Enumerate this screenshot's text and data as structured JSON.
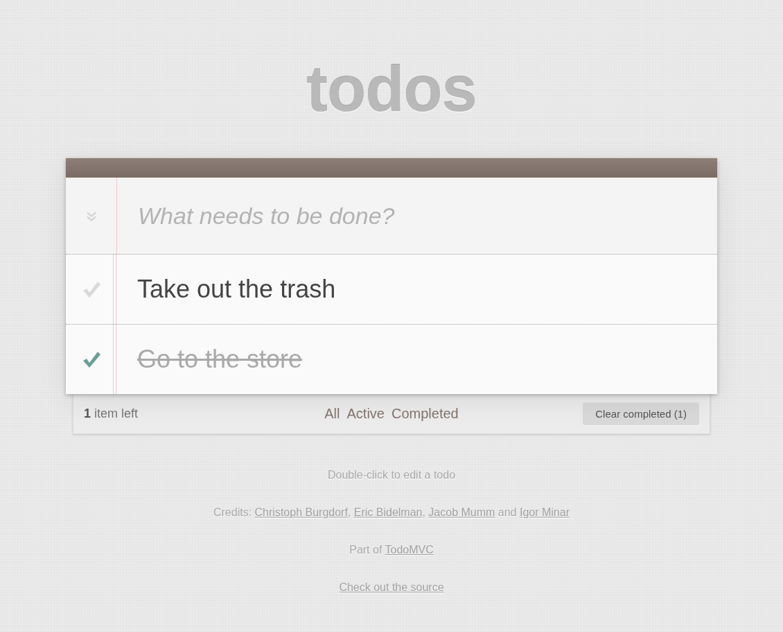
{
  "title": "todos",
  "new_todo": {
    "placeholder": "What needs to be done?",
    "toggle_all_checked": false
  },
  "todos": [
    {
      "title": "Take out the trash",
      "completed": false
    },
    {
      "title": "Go to the store",
      "completed": true
    }
  ],
  "footer": {
    "count": "**1** item left",
    "filters": [
      {
        "label": "All",
        "selected": false
      },
      {
        "label": "Active",
        "selected": false
      },
      {
        "label": "Completed",
        "selected": false
      }
    ],
    "clear_button": "Clear completed (1)"
  },
  "info": [
    {
      "segments": [
        {
          "kind": "text",
          "text": "Double-click to edit a todo"
        }
      ]
    },
    {
      "segments": [
        {
          "kind": "text",
          "text": "Credits: "
        },
        {
          "kind": "link",
          "text": "Christoph Burgdorf"
        },
        {
          "kind": "text",
          "text": ", "
        },
        {
          "kind": "link",
          "text": "Eric Bidelman"
        },
        {
          "kind": "text",
          "text": ", "
        },
        {
          "kind": "link",
          "text": "Jacob Mumm"
        },
        {
          "kind": "text",
          "text": " and "
        },
        {
          "kind": "link",
          "text": "Igor Minar"
        }
      ]
    },
    {
      "segments": [
        {
          "kind": "text",
          "text": "Part of "
        },
        {
          "kind": "link",
          "text": "TodoMVC"
        }
      ]
    },
    {
      "segments": [
        {
          "kind": "link",
          "text": "Check out the source"
        }
      ]
    }
  ]
}
